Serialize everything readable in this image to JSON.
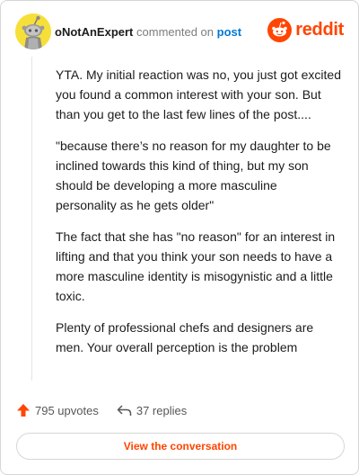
{
  "comment": {
    "username": "oNotAnExpert",
    "action_text": "commented on",
    "post_link": "post",
    "paragraphs": [
      "YTA. My initial reaction was no, you just got excited you found a common interest with your son. But than you get to the last few lines of the post....",
      "\"because there’s no reason for my daughter to be inclined towards this kind of thing, but my son should be developing a more masculine personality as he gets older\"",
      "The fact that she has \"no reason\" for an interest in lifting and that you think your son needs to have a more masculine identity is misogynistic and a little toxic.",
      "Plenty of professional chefs and designers are men. Your overall perception is the problem"
    ]
  },
  "brand": {
    "name": "reddit",
    "icon": "reddit-logo-icon",
    "color": "#ff4500"
  },
  "stats": {
    "upvotes": "795 upvotes",
    "replies": "37 replies",
    "upvote_icon": "upvote-arrow-icon",
    "reply_icon": "reply-arrow-icon"
  },
  "cta": {
    "label": "View the conversation"
  },
  "colors": {
    "accent": "#ff4500",
    "link": "#0079d3",
    "avatar": "#f7df3a",
    "muted": "#7c7c7c",
    "border": "#d6d6d6"
  }
}
